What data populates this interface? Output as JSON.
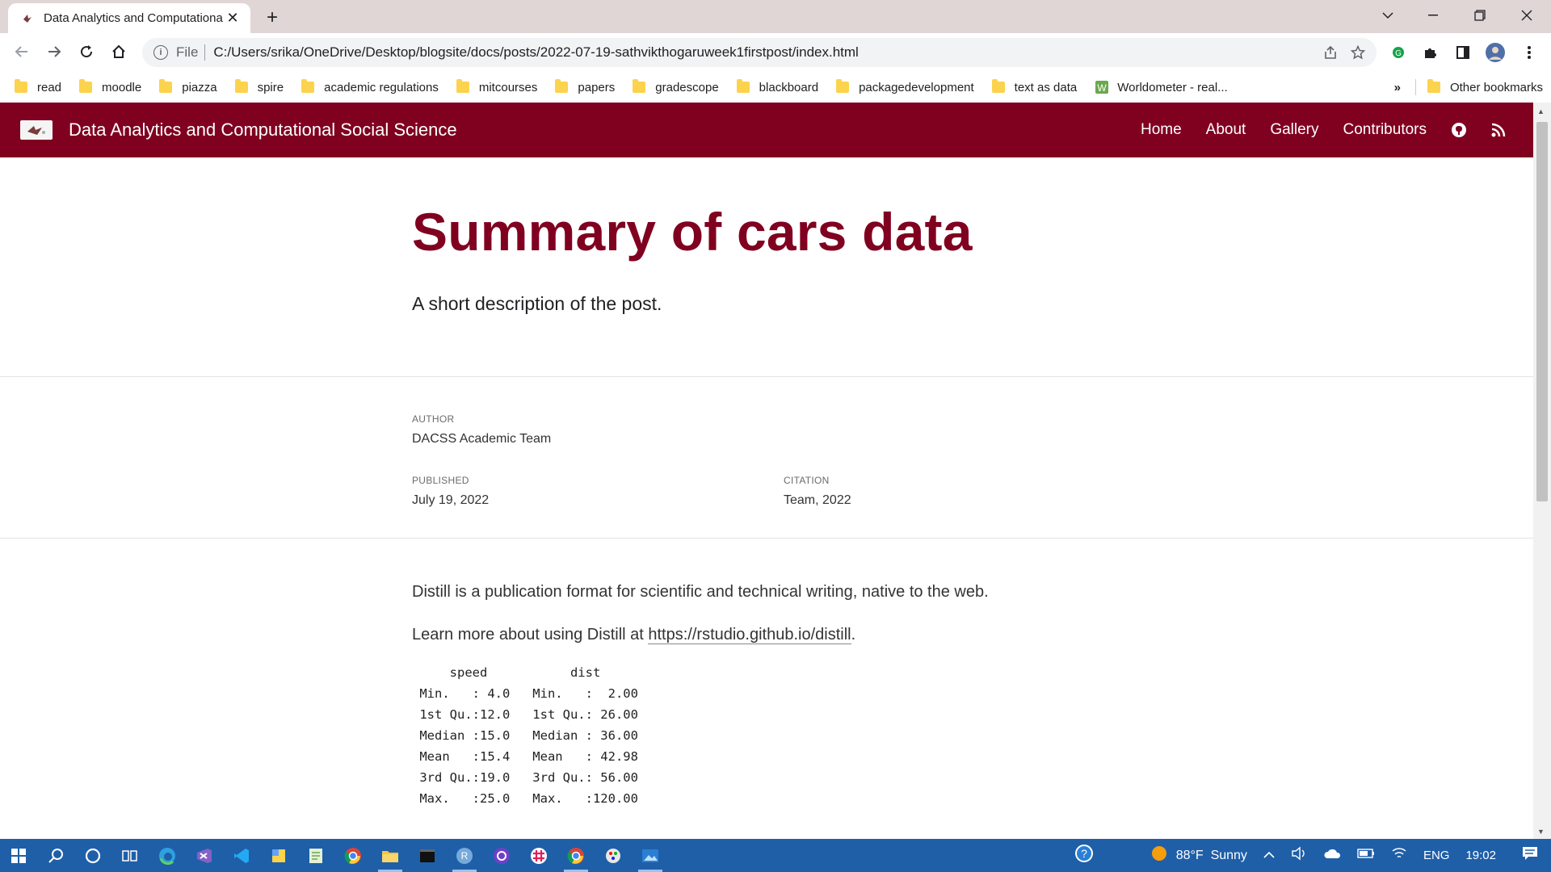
{
  "browser": {
    "tab_title": "Data Analytics and Computationa",
    "url_scheme": "File",
    "url": "C:/Users/srika/OneDrive/Desktop/blogsite/docs/posts/2022-07-19-sathvikthogaruweek1firstpost/index.html",
    "bookmarks": [
      {
        "label": "read"
      },
      {
        "label": "moodle"
      },
      {
        "label": "piazza"
      },
      {
        "label": "spire"
      },
      {
        "label": "academic regulations"
      },
      {
        "label": "mitcourses"
      },
      {
        "label": "papers"
      },
      {
        "label": "gradescope"
      },
      {
        "label": "blackboard"
      },
      {
        "label": "packagedevelopment"
      },
      {
        "label": "text as data"
      },
      {
        "label": "Worldometer - real..."
      }
    ],
    "overflow_label": "»",
    "other_bookmarks": "Other bookmarks"
  },
  "site": {
    "title": "Data Analytics and Computational Social Science",
    "nav": [
      "Home",
      "About",
      "Gallery",
      "Contributors"
    ]
  },
  "post": {
    "title": "Summary of cars data",
    "description": "A short description of the post.",
    "author_label": "AUTHOR",
    "author": "DACSS Academic Team",
    "published_label": "PUBLISHED",
    "published": "July 19, 2022",
    "citation_label": "CITATION",
    "citation": "Team, 2022",
    "para1": "Distill is a publication format for scientific and technical writing, native to the web.",
    "para2_prefix": "Learn more about using Distill at ",
    "para2_link": "https://rstudio.github.io/distill",
    "para2_suffix": ".",
    "code_output": "     speed           dist       \n Min.   : 4.0   Min.   :  2.00  \n 1st Qu.:12.0   1st Qu.: 26.00  \n Median :15.0   Median : 36.00  \n Mean   :15.4   Mean   : 42.98  \n 3rd Qu.:19.0   3rd Qu.: 56.00  \n Max.   :25.0   Max.   :120.00  "
  },
  "taskbar": {
    "weather": "88°F  Sunny",
    "lang": "ENG",
    "time": "19:02"
  },
  "colors": {
    "brand": "#800020",
    "taskbar": "#1f5fa8"
  }
}
